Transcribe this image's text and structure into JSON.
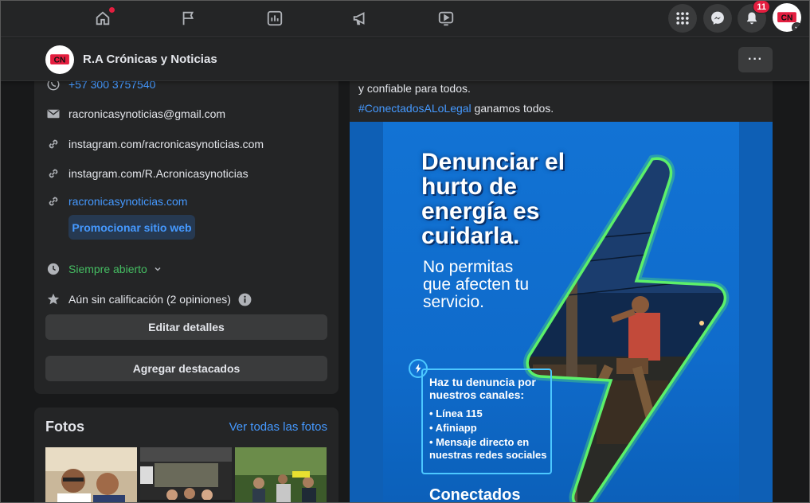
{
  "nav": {
    "notifications_count": "11",
    "icons": [
      "home-icon",
      "flag-icon",
      "insights-icon",
      "megaphone-icon",
      "video-icon"
    ]
  },
  "pagebar": {
    "name": "R.A Crónicas y Noticias",
    "more_label": "···"
  },
  "about": {
    "whatsapp": "+57 300 3757540",
    "email": "racronicasynoticias@gmail.com",
    "instagram1": "instagram.com/racronicasynoticias.com",
    "instagram2": "instagram.com/R.Acronicasynoticias",
    "website": "racronicasynoticias.com",
    "promote_label": "Promocionar sitio web",
    "hours": "Siempre abierto",
    "rating": "Aún sin calificación (2 opiniones)",
    "edit_label": "Editar detalles",
    "featured_label": "Agregar destacados"
  },
  "photos": {
    "title": "Fotos",
    "see_all": "Ver todas las fotos"
  },
  "post": {
    "text1": "y confiable para todos.",
    "hashtag": "#ConectadosALoLegal",
    "text2_rest": " ganamos todos.",
    "image": {
      "headline": "Denunciar el hurto de energía es cuidarla.",
      "subline": "No permitas que afecten tu servicio.",
      "box_title": "Haz tu denuncia por nuestros canales:",
      "channels": [
        "• Línea 115",
        "• Afiniapp",
        "• Mensaje directo en nuestras redes sociales"
      ],
      "footer": "Conectados"
    }
  },
  "colors": {
    "accent": "#4599ff",
    "green": "#45bd62",
    "badge": "#e41e3f",
    "bolt": "#5cf06a"
  }
}
